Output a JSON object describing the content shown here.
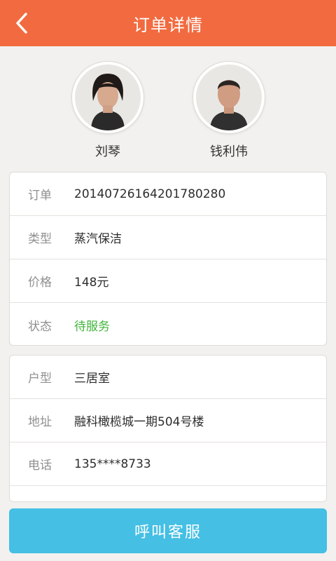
{
  "colors": {
    "header_bg": "#f26a3f",
    "status_green": "#3fb43a",
    "button_bg": "#45bfe4"
  },
  "header": {
    "title": "订单详情",
    "back_icon": "chevron-left-icon"
  },
  "staff": [
    {
      "name": "刘琴",
      "icon": "avatar-photo"
    },
    {
      "name": "钱利伟",
      "icon": "avatar-photo"
    }
  ],
  "order_info": [
    {
      "label": "订单",
      "value": "20140726164201780280"
    },
    {
      "label": "类型",
      "value": "蒸汽保洁"
    },
    {
      "label": "价格",
      "value": "148元"
    },
    {
      "label": "状态",
      "value": "待服务"
    }
  ],
  "house_info": [
    {
      "label": "户型",
      "value": "三居室"
    },
    {
      "label": "地址",
      "value": "融科橄榄城一期504号楼"
    },
    {
      "label": "电话",
      "value": "135****8733"
    }
  ],
  "footer": {
    "call_button": "呼叫客服"
  }
}
